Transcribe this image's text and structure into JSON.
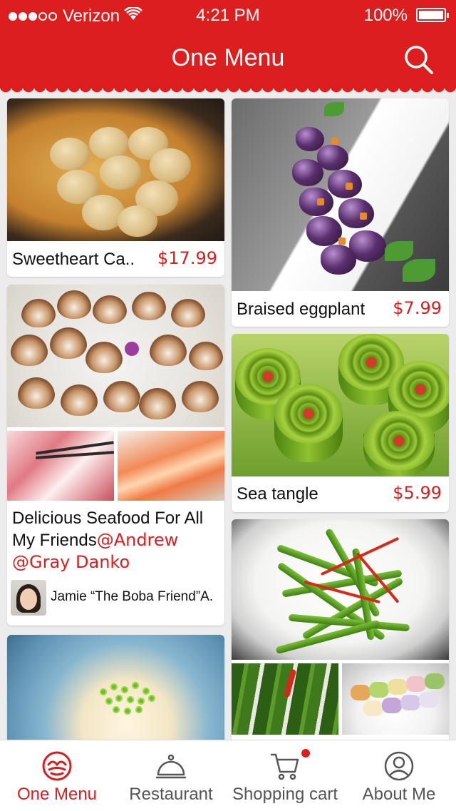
{
  "status_bar": {
    "carrier": "Verizon",
    "time": "4:21 PM",
    "battery": "100%"
  },
  "header": {
    "title": "One Menu",
    "search_icon": "search-icon"
  },
  "colors": {
    "brand_red": "#dc1e1e",
    "price_red": "#d81e1e",
    "background": "#ececec"
  },
  "feed": {
    "left": [
      {
        "caption": "Sweetheart Ca..",
        "price": "$17.99"
      },
      {
        "post_line1": "Delicious Seafood For All",
        "post_line2_text": "My Friends",
        "mention_1": "@Andrew",
        "mention_2": "@Gray Danko",
        "author": "Jamie “The Boba Friend”A."
      }
    ],
    "right": [
      {
        "caption": "Braised eggplant",
        "price": "$7.99"
      },
      {
        "caption": "Sea tangle",
        "price": "$5.99"
      }
    ]
  },
  "tabbar": {
    "tabs": [
      {
        "label": "One Menu",
        "icon": "one-menu-logo-icon",
        "active": true
      },
      {
        "label": "Restaurant",
        "icon": "cloche-icon",
        "active": false
      },
      {
        "label": "Shopping cart",
        "icon": "cart-icon",
        "active": false,
        "has_badge": true
      },
      {
        "label": "About Me",
        "icon": "user-icon",
        "active": false
      }
    ]
  }
}
